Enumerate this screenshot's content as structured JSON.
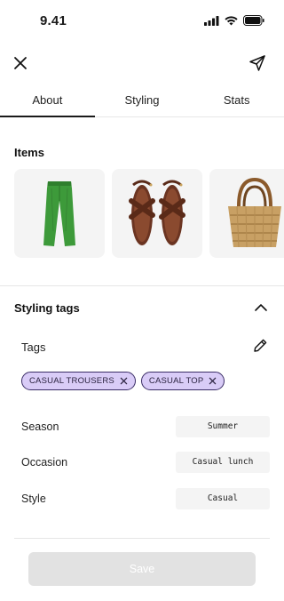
{
  "status_bar": {
    "time": "9.41",
    "icons": [
      "signal-icon",
      "wifi-icon",
      "battery-icon"
    ]
  },
  "top_bar": {
    "close_icon": "close-icon",
    "share_icon": "send-icon"
  },
  "tabs": [
    {
      "label": "About",
      "active": true
    },
    {
      "label": "Styling",
      "active": false
    },
    {
      "label": "Stats",
      "active": false
    }
  ],
  "items_section": {
    "title": "Items",
    "items": [
      {
        "name": "green-trousers"
      },
      {
        "name": "brown-sandals"
      },
      {
        "name": "straw-tote-bag"
      }
    ]
  },
  "styling_tags": {
    "title": "Styling tags",
    "expanded": true,
    "tags_label": "Tags",
    "tags": [
      "CASUAL TROUSERS",
      "CASUAL TOP"
    ],
    "fields": {
      "season": {
        "label": "Season",
        "value": "Summer"
      },
      "occasion": {
        "label": "Occasion",
        "value": "Casual lunch"
      },
      "style": {
        "label": "Style",
        "value": "Casual"
      }
    }
  },
  "save_button": {
    "label": "Save",
    "enabled": false
  },
  "colors": {
    "chip_fill": "#d9ccf7",
    "chip_border": "#3a2d66",
    "field_bg": "#f4f4f4",
    "save_disabled_bg": "#e2e2e2"
  }
}
